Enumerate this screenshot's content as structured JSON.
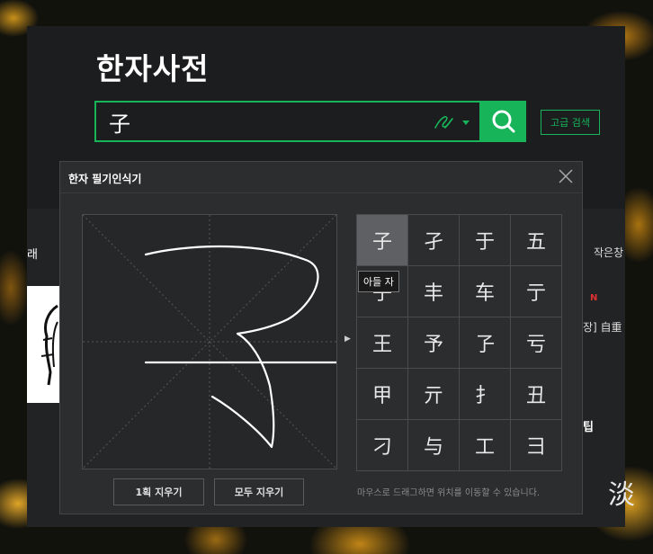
{
  "page": {
    "title": "한자사전"
  },
  "search": {
    "value": "子",
    "advanced_label": "고급 검색",
    "handwriting_icon": "pen-icon",
    "search_icon": "search-icon"
  },
  "background": {
    "left_tab": "래",
    "right_tab": "작은창",
    "right_new_badge": "N",
    "right_fragment": "장] 自重",
    "right_tip": "팁",
    "right_deco": "淡"
  },
  "handwriting": {
    "title": "한자 필기인식기",
    "clear_one_label": "1획 지우기",
    "clear_all_label": "모두 지우기",
    "hint": "마우스로 드래그하면 위치를 이동할 수 있습니다.",
    "candidates": [
      "子",
      "孑",
      "于",
      "五",
      "子",
      "丰",
      "车",
      "亍",
      "王",
      "予",
      "孒",
      "亏",
      "甲",
      "亓",
      "扌",
      "丑",
      "刁",
      "与",
      "工",
      "彐"
    ],
    "selected_index": 0,
    "tooltip": "아들 자"
  },
  "colors": {
    "accent": "#18b45a",
    "panel": "#1c1d1e",
    "popup": "#2c2d2f"
  }
}
